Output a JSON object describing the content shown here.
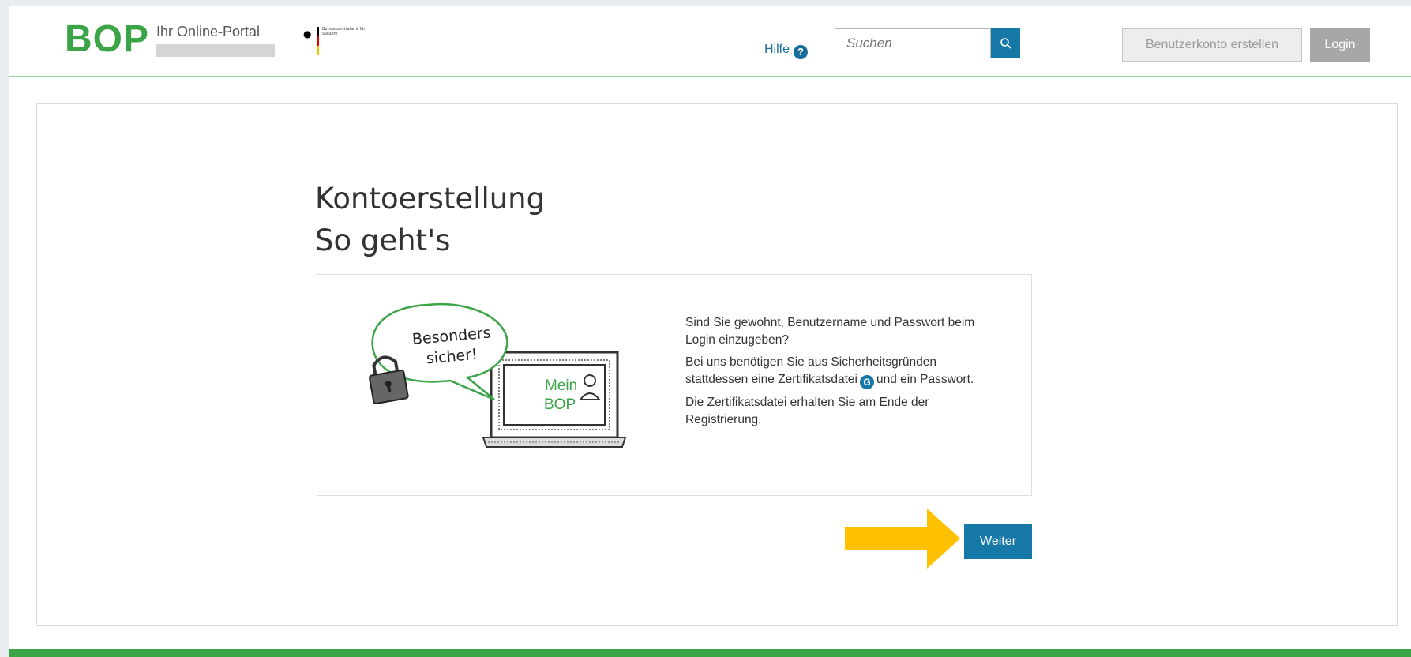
{
  "header": {
    "logo": "BOP",
    "portal_title": "Ihr Online-Portal",
    "gov_text": "Bundeszentralamt für Steuern",
    "help_label": "Hilfe",
    "help_icon": "?",
    "search_placeholder": "Suchen",
    "register_label": "Benutzerkonto erstellen",
    "login_label": "Login"
  },
  "main": {
    "title_line1": "Kontoerstellung",
    "title_line2": "So geht's",
    "illustration": {
      "bubble_line1": "Besonders",
      "bubble_line2": "sicher!",
      "screen_line1": "Mein",
      "screen_line2": "BOP"
    },
    "paragraph1": "Sind Sie gewohnt, Benutzername und Passwort beim Login einzugeben?",
    "paragraph2_before": "Bei uns benötigen Sie aus Sicherheitsgründen stattdessen eine Zertifikatsdatei",
    "paragraph2_icon": "G",
    "paragraph2_after": "und ein Passwort.",
    "paragraph3": "Die Zertifikatsdatei erhalten Sie am Ende der Registrierung.",
    "next_label": "Weiter"
  },
  "colors": {
    "brand_green": "#3aa447",
    "primary_blue": "#1678a6",
    "highlight_arrow": "#ffc000"
  }
}
